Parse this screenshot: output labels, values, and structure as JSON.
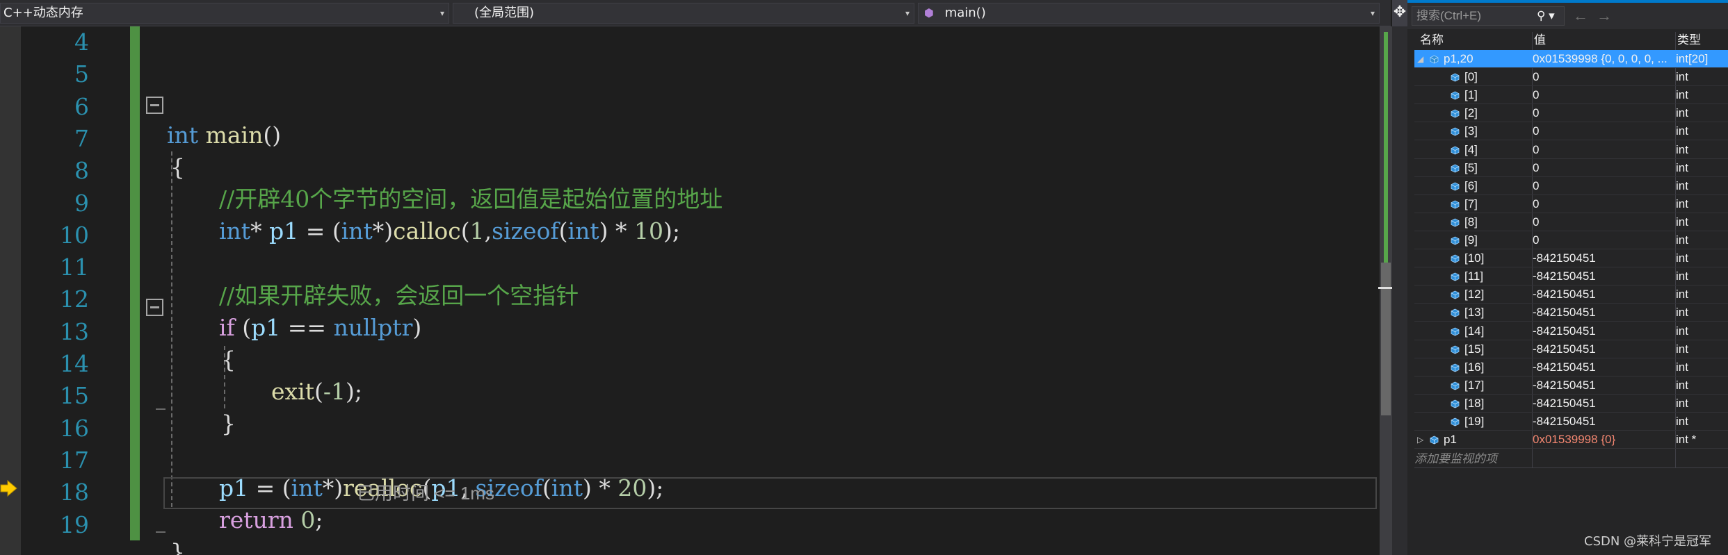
{
  "navbar": {
    "project": "C++动态内存",
    "scope": "(全局范围)",
    "member": "main()"
  },
  "editor": {
    "line_numbers": [
      "4",
      "5",
      "6",
      "7",
      "8",
      "9",
      "10",
      "11",
      "12",
      "13",
      "14",
      "15",
      "16",
      "17",
      "18",
      "19"
    ],
    "current_line": "18",
    "perf_tip": "已用时间 <= 1ms"
  },
  "watch": {
    "search_placeholder": "搜索(Ctrl+E)",
    "headers": {
      "name": "名称",
      "value": "值",
      "type": "类型"
    },
    "rows": [
      {
        "name": "p1,20",
        "value": "0x01539998 {0, 0, 0, 0, ...",
        "type": "int[20]",
        "level": 0,
        "expanded": true,
        "selected": true
      },
      {
        "name": "[0]",
        "value": "0",
        "type": "int",
        "level": 1
      },
      {
        "name": "[1]",
        "value": "0",
        "type": "int",
        "level": 1
      },
      {
        "name": "[2]",
        "value": "0",
        "type": "int",
        "level": 1
      },
      {
        "name": "[3]",
        "value": "0",
        "type": "int",
        "level": 1
      },
      {
        "name": "[4]",
        "value": "0",
        "type": "int",
        "level": 1
      },
      {
        "name": "[5]",
        "value": "0",
        "type": "int",
        "level": 1
      },
      {
        "name": "[6]",
        "value": "0",
        "type": "int",
        "level": 1
      },
      {
        "name": "[7]",
        "value": "0",
        "type": "int",
        "level": 1
      },
      {
        "name": "[8]",
        "value": "0",
        "type": "int",
        "level": 1
      },
      {
        "name": "[9]",
        "value": "0",
        "type": "int",
        "level": 1
      },
      {
        "name": "[10]",
        "value": "-842150451",
        "type": "int",
        "level": 1
      },
      {
        "name": "[11]",
        "value": "-842150451",
        "type": "int",
        "level": 1
      },
      {
        "name": "[12]",
        "value": "-842150451",
        "type": "int",
        "level": 1
      },
      {
        "name": "[13]",
        "value": "-842150451",
        "type": "int",
        "level": 1
      },
      {
        "name": "[14]",
        "value": "-842150451",
        "type": "int",
        "level": 1
      },
      {
        "name": "[15]",
        "value": "-842150451",
        "type": "int",
        "level": 1
      },
      {
        "name": "[16]",
        "value": "-842150451",
        "type": "int",
        "level": 1
      },
      {
        "name": "[17]",
        "value": "-842150451",
        "type": "int",
        "level": 1
      },
      {
        "name": "[18]",
        "value": "-842150451",
        "type": "int",
        "level": 1
      },
      {
        "name": "[19]",
        "value": "-842150451",
        "type": "int",
        "level": 1
      },
      {
        "name": "p1",
        "value": "0x01539998 {0}",
        "type": "int *",
        "level": 0,
        "expanded": false,
        "changed": true
      }
    ],
    "add_item": "添加要监视的项"
  },
  "watermark": "CSDN @莱科宁是冠军",
  "colors": {
    "accent": "#007acc",
    "selection": "#3399ff",
    "keyword": "#569cd6",
    "comment": "#57a64a",
    "function": "#dcdcaa",
    "number": "#b5cea8",
    "changed_value": "#f48771"
  },
  "icons": {
    "exec_pointer": "yellow-arrow-icon",
    "watch_item": "blue-cube-icon",
    "search": "magnifier-icon"
  }
}
